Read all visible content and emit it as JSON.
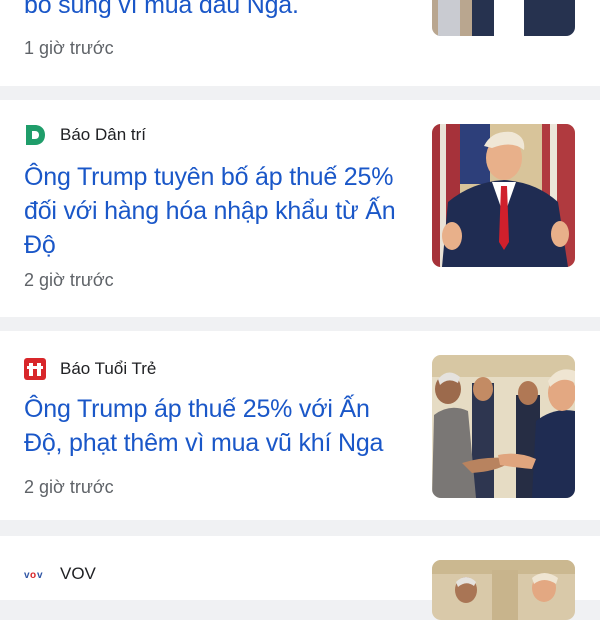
{
  "articles": [
    {
      "headline": "bổ sung vì mua dầu Nga.",
      "time": "1 giờ trước"
    },
    {
      "source": "Báo Dân trí",
      "logo_icon": "dan-tri-logo",
      "headline": "Ông Trump tuyên bố áp thuế 25% đối với hàng hóa nhập khẩu từ Ấn Độ",
      "time": "2 giờ trước"
    },
    {
      "source": "Báo Tuổi Trẻ",
      "logo_icon": "tuoi-tre-logo",
      "headline": "Ông Trump áp thuế 25% với Ấn Độ, phạt thêm vì mua vũ khí Nga",
      "time": "2 giờ trước"
    },
    {
      "source": "VOV",
      "logo_icon": "vov-logo"
    }
  ],
  "colors": {
    "headline": "#1a57c8",
    "meta": "#5f6368",
    "separator": "#f0f1f3"
  }
}
